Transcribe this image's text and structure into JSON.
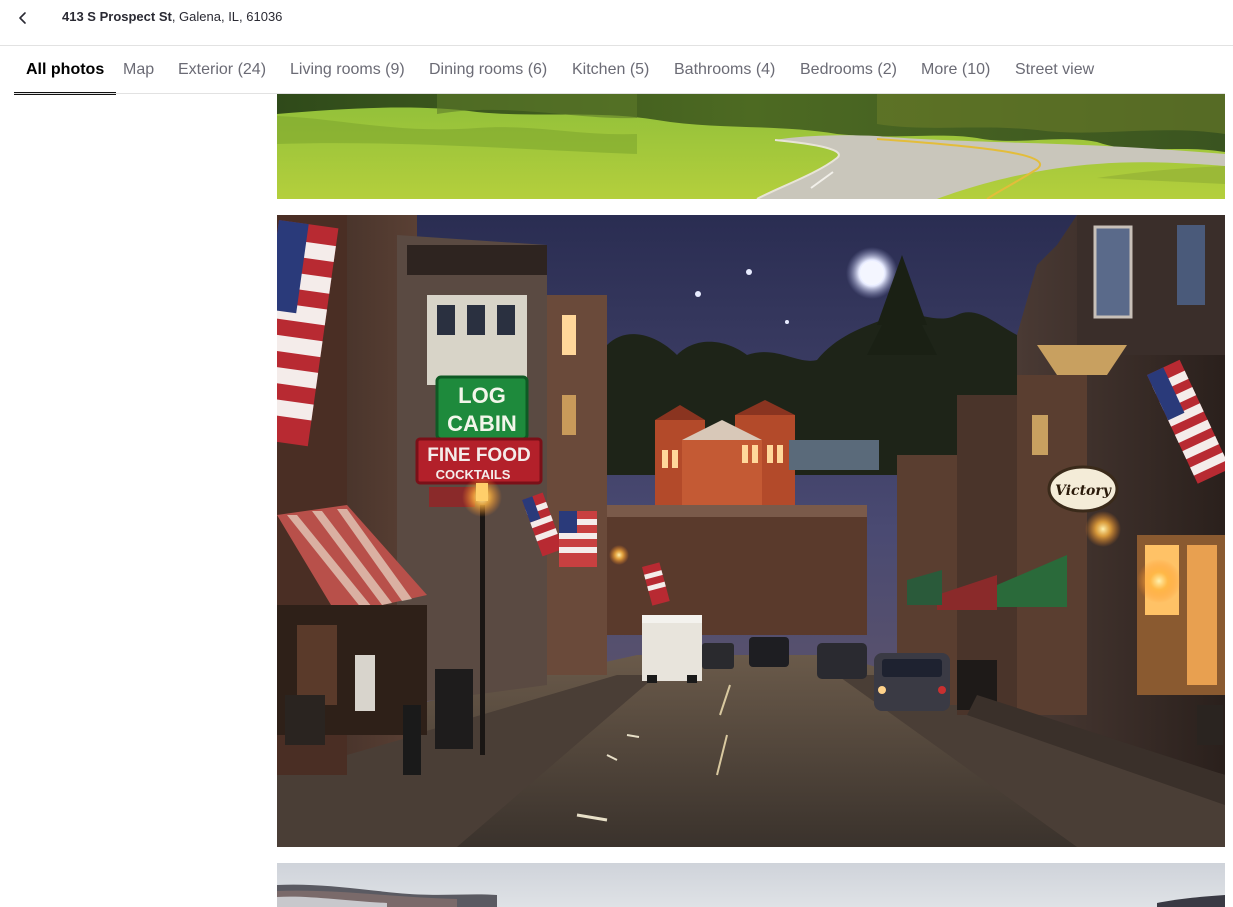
{
  "header": {
    "back_icon": "chevron-left-icon",
    "address_street": "413 S Prospect St",
    "address_rest": ", Galena, IL, 61036"
  },
  "tabs": [
    {
      "label": "All photos",
      "active": true
    },
    {
      "label": "Map",
      "active": false
    },
    {
      "label": "Exterior (24)",
      "active": false
    },
    {
      "label": "Living rooms (9)",
      "active": false
    },
    {
      "label": "Dining rooms (6)",
      "active": false
    },
    {
      "label": "Kitchen (5)",
      "active": false
    },
    {
      "label": "Bathrooms (4)",
      "active": false
    },
    {
      "label": "Bedrooms (2)",
      "active": false
    },
    {
      "label": "More (10)",
      "active": false
    },
    {
      "label": "Street view",
      "active": false
    }
  ],
  "photos": {
    "sign_log": "LOG",
    "sign_cabin": "CABIN",
    "sign_fine_food": "FINE FOOD",
    "sign_cocktails": "COCKTAILS",
    "sign_victory": "Victory"
  },
  "colors": {
    "active_tab": "#000000",
    "inactive_tab": "#6b6b75",
    "divider": "#e2e2e2",
    "sign_green": "#1e8a3c",
    "sign_red": "#b3202a"
  }
}
